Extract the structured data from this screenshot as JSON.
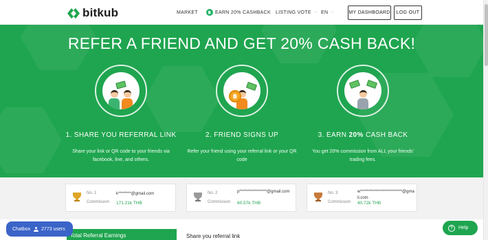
{
  "brand": {
    "name": "bitkub"
  },
  "nav": {
    "market": "MARKET",
    "earn": "EARN 20% CASHBACK",
    "listing": "LISTING VOTE",
    "language": "EN",
    "dashboard": "MY DASHBOARD",
    "logout": "LOG OUT"
  },
  "hero": {
    "title": "REFER A FRIEND AND GET 20% CASH BACK!",
    "steps": [
      {
        "title": "1. SHARE YOU REFERRAL LINK",
        "desc": "Share your link or QR code to your friends via facebook, line, and others."
      },
      {
        "title": "2. FRIEND SIGNS UP",
        "desc": "Refer your friend using your referral link or your QR code"
      },
      {
        "title_pre": "3. EARN ",
        "title_bold": "20%",
        "title_post": " CASH BACK",
        "desc": "You get 20% commission from ALL your friends' trading fees."
      }
    ]
  },
  "leaderboard": [
    {
      "rank": "No. 1",
      "email": "k********@gmail.com",
      "commission_label": "Commission",
      "amount": "171.21k THB"
    },
    {
      "rank": "No. 2",
      "email": "p*****************@gmail.com",
      "commission_label": "Commission",
      "amount": "60.57k THB"
    },
    {
      "rank": "No. 3",
      "email": "w**************************@gmail.com",
      "commission_label": "Commission",
      "amount": "40.72k THB"
    }
  ],
  "bottom": {
    "earnings_tab": "Total Referral Earnings",
    "share_title": "Share you referral link"
  },
  "chat": {
    "label": "Chatbox",
    "users": "2773 users"
  },
  "help": {
    "label": "Help"
  },
  "colors": {
    "brand_green": "#1fa54f",
    "chat_blue": "#3b64c8",
    "gold": "#e0a526",
    "silver": "#9a9a9a",
    "bronze": "#c77a3a"
  }
}
